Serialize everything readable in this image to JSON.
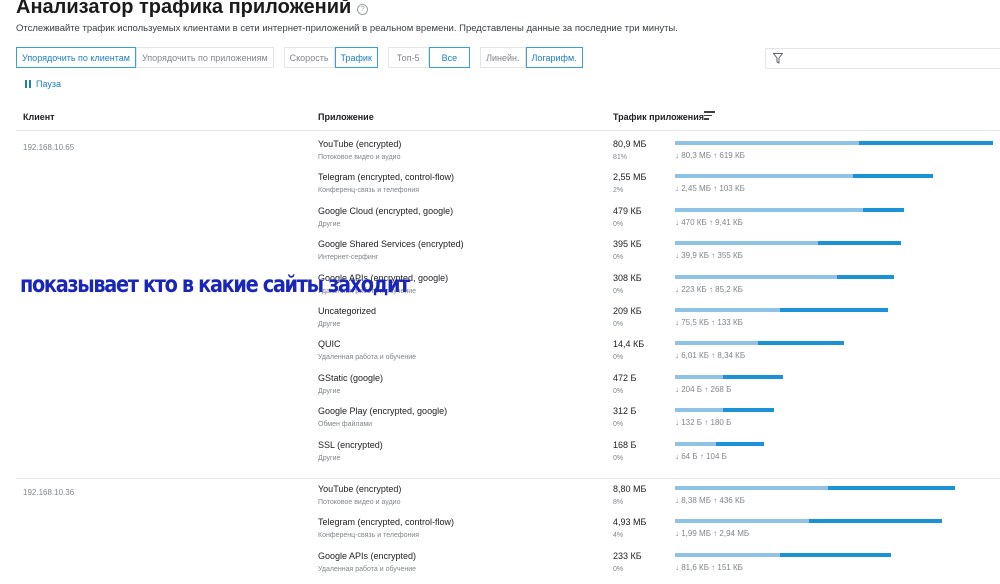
{
  "header": {
    "title": "Анализатор трафика приложений",
    "subtitle": "Отслеживайте трафик используемых клиентами в сети интернет-приложений в реальном времени. Представлены данные за последние три минуты."
  },
  "toolbar": {
    "sort_by_clients": "Упорядочить по клиентам",
    "sort_by_apps": "Упорядочить по приложениям",
    "speed": "Скорость",
    "traffic": "Трафик",
    "top5": "Топ-5",
    "all": "Все",
    "linear": "Линейн.",
    "log": "Логарифм."
  },
  "filter": {
    "placeholder": "",
    "icon": "filter-icon"
  },
  "pause_label": "Пауза",
  "table": {
    "headers": {
      "client": "Клиент",
      "app": "Приложение",
      "traffic": "Трафик приложения"
    },
    "groups": [
      {
        "client": "192.168.10.65",
        "rows": [
          {
            "app": "YouTube (encrypted)",
            "cat": "Потоковое видео и аудио",
            "traffic": "80,9 МБ",
            "pct": "81%",
            "down": "80,3 МБ",
            "up": "619 КБ",
            "bar_total": 1.0,
            "bar_down": 0.58
          },
          {
            "app": "Telegram (encrypted, control-flow)",
            "cat": "Конференц-связь и телефония",
            "traffic": "2,55 МБ",
            "pct": "2%",
            "down": "2,45 МБ",
            "up": "103 КБ",
            "bar_total": 0.81,
            "bar_down": 0.56
          },
          {
            "app": "Google Cloud (encrypted, google)",
            "cat": "Другие",
            "traffic": "479 КБ",
            "pct": "0%",
            "down": "470 КБ",
            "up": "9,41 КБ",
            "bar_total": 0.72,
            "bar_down": 0.59
          },
          {
            "app": "Google Shared Services (encrypted)",
            "cat": "Интернет-серфинг",
            "traffic": "395 КБ",
            "pct": "0%",
            "down": "39,9 КБ",
            "up": "355 КБ",
            "bar_total": 0.71,
            "bar_down": 0.45
          },
          {
            "app": "Google APIs (encrypted, google)",
            "cat": "Удаленная работа и обучение",
            "traffic": "308 КБ",
            "pct": "0%",
            "down": "223 КБ",
            "up": "85,2 КБ",
            "bar_total": 0.69,
            "bar_down": 0.51
          },
          {
            "app": "Uncategorized",
            "cat": "Другие",
            "traffic": "209 КБ",
            "pct": "0%",
            "down": "75,5 КБ",
            "up": "133 КБ",
            "bar_total": 0.67,
            "bar_down": 0.33
          },
          {
            "app": "QUIC",
            "cat": "Удаленная работа и обучение",
            "traffic": "14,4 КБ",
            "pct": "0%",
            "down": "6,01 КБ",
            "up": "8,34 КБ",
            "bar_total": 0.53,
            "bar_down": 0.26
          },
          {
            "app": "GStatic (google)",
            "cat": "Другие",
            "traffic": "472 Б",
            "pct": "0%",
            "down": "204 Б",
            "up": "268 Б",
            "bar_total": 0.34,
            "bar_down": 0.15
          },
          {
            "app": "Google Play (encrypted, google)",
            "cat": "Обмен файлами",
            "traffic": "312 Б",
            "pct": "0%",
            "down": "132 Б",
            "up": "180 Б",
            "bar_total": 0.31,
            "bar_down": 0.15
          },
          {
            "app": "SSL (encrypted)",
            "cat": "Другие",
            "traffic": "168 Б",
            "pct": "0%",
            "down": "64 Б",
            "up": "104 Б",
            "bar_total": 0.28,
            "bar_down": 0.13
          }
        ]
      },
      {
        "client": "192.168.10.36",
        "rows": [
          {
            "app": "YouTube (encrypted)",
            "cat": "Потоковое видео и аудио",
            "traffic": "8,80 МБ",
            "pct": "8%",
            "down": "8,38 МБ",
            "up": "436 КБ",
            "bar_total": 0.88,
            "bar_down": 0.48
          },
          {
            "app": "Telegram (encrypted, control-flow)",
            "cat": "Конференц-связь и телефония",
            "traffic": "4,93 МБ",
            "pct": "4%",
            "down": "1,99 МБ",
            "up": "2,94 МБ",
            "bar_total": 0.84,
            "bar_down": 0.42
          },
          {
            "app": "Google APIs (encrypted)",
            "cat": "Удаленная работа и обучение",
            "traffic": "233 КБ",
            "pct": "0%",
            "down": "81,6 КБ",
            "up": "151 КБ",
            "bar_total": 0.68,
            "bar_down": 0.33
          }
        ]
      }
    ]
  },
  "annotation": "показывает кто в какие сайты заходит",
  "colors": {
    "accent": "#1c92d6",
    "accent_light": "#8ec3e6",
    "annotation": "#1a26b8"
  }
}
